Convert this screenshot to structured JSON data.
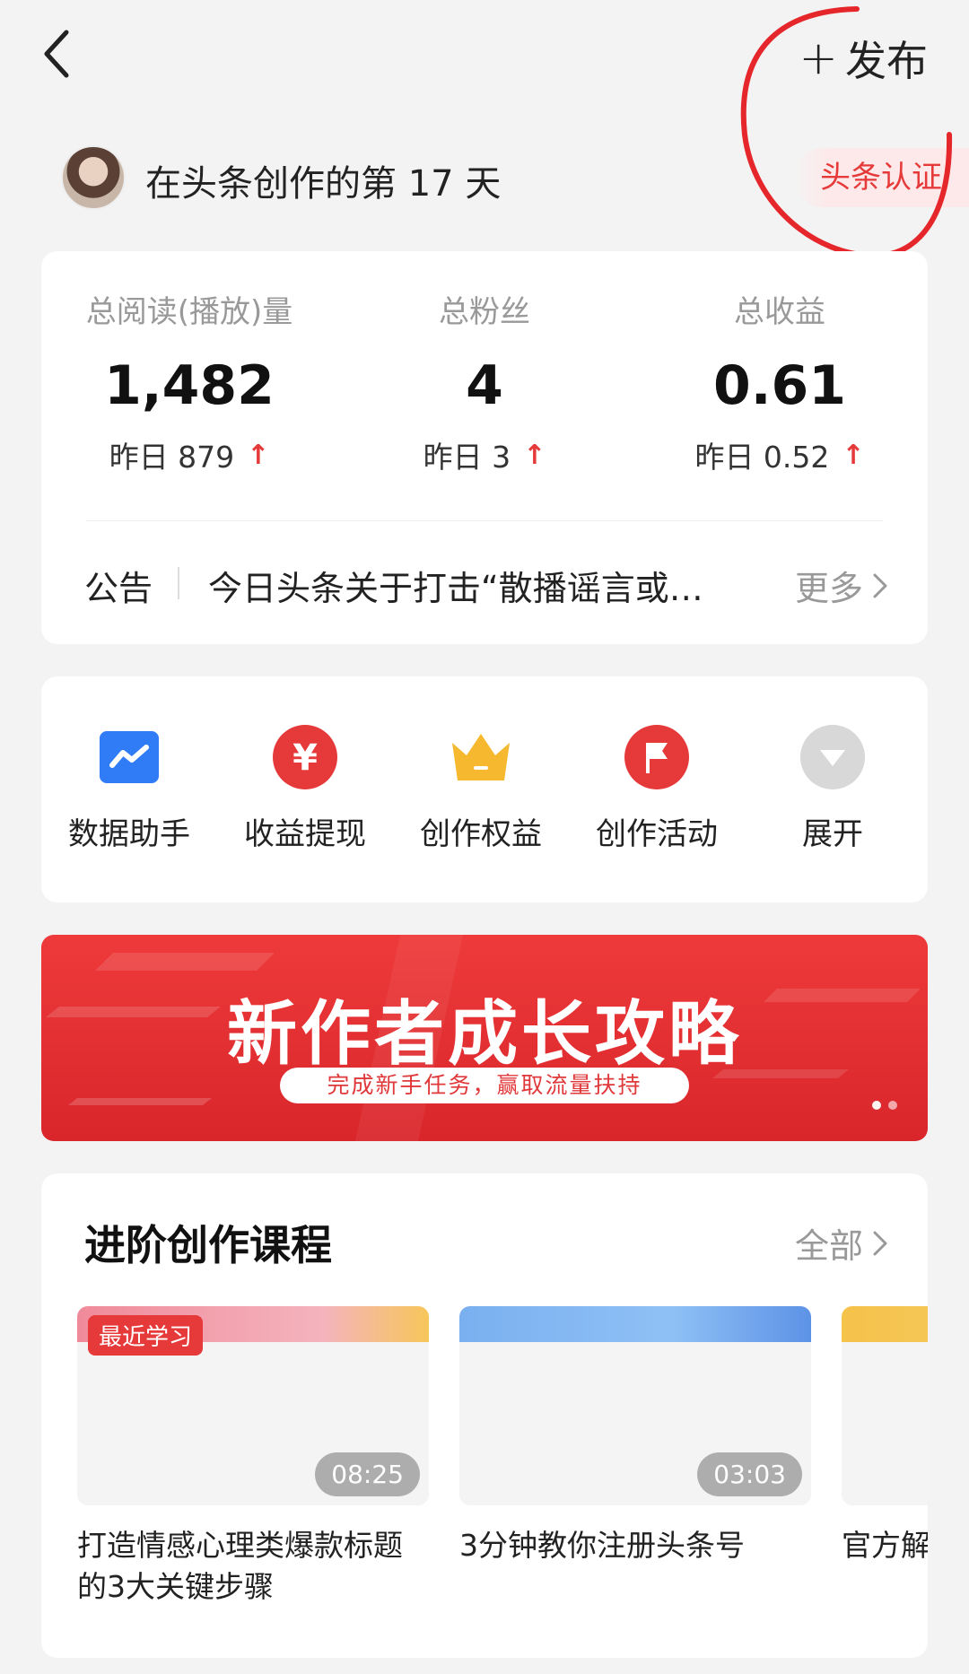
{
  "header": {
    "publish_plus": "+",
    "publish_label": "发布"
  },
  "profile": {
    "days_text": "在头条创作的第 17 天",
    "certification": "头条认证"
  },
  "stats": [
    {
      "label": "总阅读(播放)量",
      "value": "1,482",
      "yesterday": "昨日 879",
      "trend": "up"
    },
    {
      "label": "总粉丝",
      "value": "4",
      "yesterday": "昨日 3",
      "trend": "up"
    },
    {
      "label": "总收益",
      "value": "0.61",
      "yesterday": "昨日 0.52",
      "trend": "up"
    }
  ],
  "notice": {
    "label": "公告",
    "text": "今日头条关于打击“散播谣言或…",
    "more": "更多"
  },
  "tools": [
    {
      "label": "数据助手",
      "icon": "chart-icon",
      "color": "#2f7cf6"
    },
    {
      "label": "收益提现",
      "icon": "yuan-icon",
      "color": "#e63a3a"
    },
    {
      "label": "创作权益",
      "icon": "crown-icon",
      "color": "#f5b82e"
    },
    {
      "label": "创作活动",
      "icon": "flag-icon",
      "color": "#e63a3a"
    },
    {
      "label": "展开",
      "icon": "chevron-down-icon",
      "color": "#d8d8d8"
    }
  ],
  "banner": {
    "title": "新作者成长攻略",
    "subtitle": "完成新手任务，赢取流量扶持"
  },
  "courses": {
    "title": "进阶创作课程",
    "all": "全部",
    "items": [
      {
        "badge": "最近学习",
        "duration": "08:25",
        "title": "打造情感心理类爆款标题的3大关键步骤"
      },
      {
        "badge": "",
        "duration": "03:03",
        "title": "3分钟教你注册头条号"
      },
      {
        "badge": "",
        "duration": "",
        "title": "官方解头条推"
      }
    ]
  }
}
